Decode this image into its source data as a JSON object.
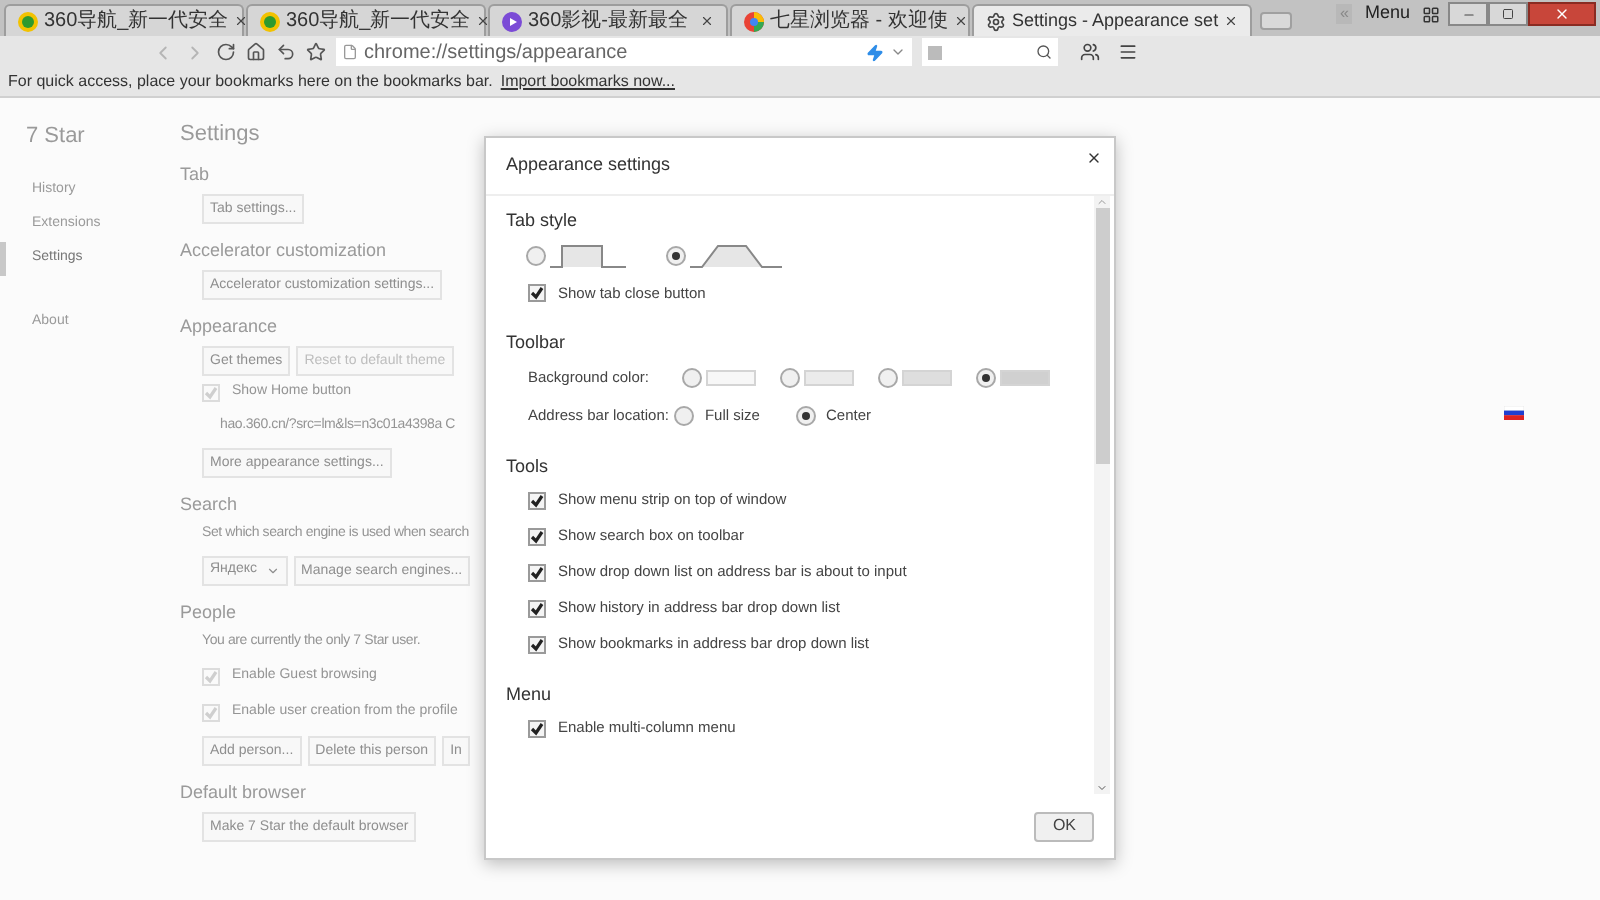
{
  "browser": {
    "tabs": [
      {
        "title": "360导航_新一代安全",
        "kind": "green-orb",
        "selected": false
      },
      {
        "title": "360导航_新一代安全",
        "kind": "green-orb",
        "selected": false
      },
      {
        "title": "360影视-最新最全",
        "kind": "play-orb",
        "selected": false
      },
      {
        "title": "七星浏览器 - 欢迎使",
        "kind": "color-orb",
        "selected": false
      },
      {
        "title": "Settings - Appearance set",
        "kind": "gear",
        "selected": true
      }
    ],
    "collapse_label": "«",
    "menu_label": "Menu",
    "address": "chrome://settings/appearance",
    "bookmarks_bar": {
      "message": "For quick access, place your bookmarks here on the bookmarks bar.",
      "link": "Import bookmarks now..."
    }
  },
  "settings_page": {
    "brand": "7 Star",
    "nav": [
      {
        "label": "History",
        "selected": false
      },
      {
        "label": "Extensions",
        "selected": false
      },
      {
        "label": "Settings",
        "selected": true
      },
      {
        "label": "About",
        "selected": false
      }
    ],
    "title": "Settings",
    "sections": [
      {
        "heading": "Tab",
        "items": [
          {
            "kind": "buttons",
            "buttons": [
              {
                "label": "Tab settings...",
                "disabled": false
              }
            ]
          }
        ]
      },
      {
        "heading": "Accelerator customization",
        "items": [
          {
            "kind": "buttons",
            "buttons": [
              {
                "label": "Accelerator customization settings...",
                "disabled": false
              }
            ]
          }
        ]
      },
      {
        "heading": "Appearance",
        "items": [
          {
            "kind": "buttons",
            "buttons": [
              {
                "label": "Get themes",
                "disabled": false
              },
              {
                "label": "Reset to default theme",
                "disabled": true
              }
            ]
          },
          {
            "kind": "checkbox",
            "label": "Show Home button",
            "checked": true
          },
          {
            "kind": "url",
            "text": "hao.360.cn/?src=lm&ls=n3c01a4398a C"
          },
          {
            "kind": "buttons",
            "buttons": [
              {
                "label": "More appearance settings...",
                "disabled": false
              }
            ]
          }
        ]
      },
      {
        "heading": "Search",
        "items": [
          {
            "kind": "text",
            "text": "Set which search engine is used when search"
          },
          {
            "kind": "select",
            "value": "Яндекс",
            "button": "Manage search engines..."
          }
        ]
      },
      {
        "heading": "People",
        "items": [
          {
            "kind": "text",
            "text": "You are currently the only 7 Star user."
          },
          {
            "kind": "checkbox",
            "label": "Enable Guest browsing",
            "checked": true
          },
          {
            "kind": "checkbox",
            "label": "Enable user creation from the profile",
            "checked": true
          },
          {
            "kind": "buttons",
            "buttons": [
              {
                "label": "Add person...",
                "disabled": false
              },
              {
                "label": "Delete this person",
                "disabled": false
              },
              {
                "label": "In",
                "disabled": false
              }
            ]
          }
        ]
      },
      {
        "heading": "Default browser",
        "items": [
          {
            "kind": "buttons",
            "buttons": [
              {
                "label": "Make 7 Star the default browser",
                "disabled": false
              }
            ]
          }
        ]
      }
    ]
  },
  "dialog": {
    "title": "Appearance settings",
    "tab_style": {
      "heading": "Tab style",
      "options": [
        {
          "kind": "square",
          "selected": false
        },
        {
          "kind": "trapezoid",
          "selected": true
        }
      ],
      "close_button": {
        "label": "Show tab close button",
        "checked": true
      }
    },
    "toolbar": {
      "heading": "Toolbar",
      "color_label": "Background color:",
      "colors": [
        {
          "color": "#f7f7f7",
          "selected": false
        },
        {
          "color": "#ebebeb",
          "selected": false
        },
        {
          "color": "#dedede",
          "selected": false
        },
        {
          "color": "#d0d0d0",
          "selected": true
        }
      ],
      "location_label": "Address bar location:",
      "locations": [
        {
          "label": "Full size",
          "selected": false
        },
        {
          "label": "Center",
          "selected": true
        }
      ]
    },
    "tools": {
      "heading": "Tools",
      "options": [
        {
          "label": "Show menu strip on top of window",
          "checked": true
        },
        {
          "label": "Show search box on toolbar",
          "checked": true
        },
        {
          "label": "Show drop down list on address bar is about to input",
          "checked": true
        },
        {
          "label": "Show history in address bar drop down list",
          "checked": true
        },
        {
          "label": "Show bookmarks in address bar drop down list",
          "checked": true
        }
      ]
    },
    "menu": {
      "heading": "Menu",
      "options": [
        {
          "label": "Enable multi-column menu",
          "checked": true
        }
      ]
    },
    "ok": "OK"
  }
}
